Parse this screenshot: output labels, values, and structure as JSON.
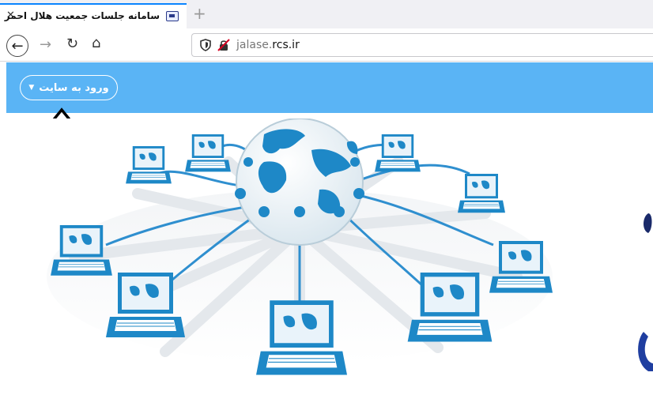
{
  "browser": {
    "tab": {
      "title": "سامانه جلسات جمعیت هلال احمر",
      "close_icon": "close-icon",
      "favicon": "site-favicon-icon"
    },
    "new_tab_icon": "plus-icon",
    "nav": {
      "back_icon": "back-arrow-icon",
      "forward_icon": "forward-arrow-icon",
      "reload_icon": "reload-icon",
      "home_icon": "home-icon"
    },
    "address": {
      "prefix": "jalase.",
      "domain": "rcs.ir",
      "shield_icon": "tracking-shield-icon",
      "insecure_icon": "insecure-lock-icon"
    }
  },
  "header": {
    "background": "#5ab4f5",
    "login_button": {
      "label": "ورود به سایت",
      "caret_icon": "caret-down-icon"
    }
  },
  "annotation": {
    "arrow_icon": "up-arrow-outline-icon"
  },
  "hero": {
    "image": "globe-network-laptops-illustration",
    "accent": "#1e88c7"
  }
}
